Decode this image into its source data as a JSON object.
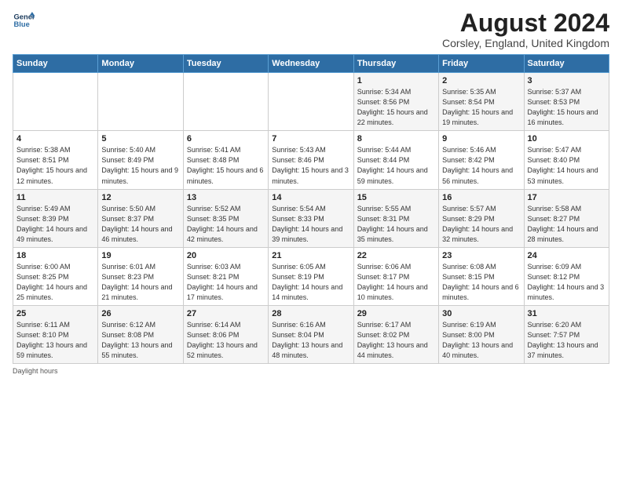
{
  "header": {
    "logo_line1": "General",
    "logo_line2": "Blue",
    "title": "August 2024",
    "subtitle": "Corsley, England, United Kingdom"
  },
  "weekdays": [
    "Sunday",
    "Monday",
    "Tuesday",
    "Wednesday",
    "Thursday",
    "Friday",
    "Saturday"
  ],
  "weeks": [
    [
      {
        "day": "",
        "content": ""
      },
      {
        "day": "",
        "content": ""
      },
      {
        "day": "",
        "content": ""
      },
      {
        "day": "",
        "content": ""
      },
      {
        "day": "1",
        "content": "Sunrise: 5:34 AM\nSunset: 8:56 PM\nDaylight: 15 hours\nand 22 minutes."
      },
      {
        "day": "2",
        "content": "Sunrise: 5:35 AM\nSunset: 8:54 PM\nDaylight: 15 hours\nand 19 minutes."
      },
      {
        "day": "3",
        "content": "Sunrise: 5:37 AM\nSunset: 8:53 PM\nDaylight: 15 hours\nand 16 minutes."
      }
    ],
    [
      {
        "day": "4",
        "content": "Sunrise: 5:38 AM\nSunset: 8:51 PM\nDaylight: 15 hours\nand 12 minutes."
      },
      {
        "day": "5",
        "content": "Sunrise: 5:40 AM\nSunset: 8:49 PM\nDaylight: 15 hours\nand 9 minutes."
      },
      {
        "day": "6",
        "content": "Sunrise: 5:41 AM\nSunset: 8:48 PM\nDaylight: 15 hours\nand 6 minutes."
      },
      {
        "day": "7",
        "content": "Sunrise: 5:43 AM\nSunset: 8:46 PM\nDaylight: 15 hours\nand 3 minutes."
      },
      {
        "day": "8",
        "content": "Sunrise: 5:44 AM\nSunset: 8:44 PM\nDaylight: 14 hours\nand 59 minutes."
      },
      {
        "day": "9",
        "content": "Sunrise: 5:46 AM\nSunset: 8:42 PM\nDaylight: 14 hours\nand 56 minutes."
      },
      {
        "day": "10",
        "content": "Sunrise: 5:47 AM\nSunset: 8:40 PM\nDaylight: 14 hours\nand 53 minutes."
      }
    ],
    [
      {
        "day": "11",
        "content": "Sunrise: 5:49 AM\nSunset: 8:39 PM\nDaylight: 14 hours\nand 49 minutes."
      },
      {
        "day": "12",
        "content": "Sunrise: 5:50 AM\nSunset: 8:37 PM\nDaylight: 14 hours\nand 46 minutes."
      },
      {
        "day": "13",
        "content": "Sunrise: 5:52 AM\nSunset: 8:35 PM\nDaylight: 14 hours\nand 42 minutes."
      },
      {
        "day": "14",
        "content": "Sunrise: 5:54 AM\nSunset: 8:33 PM\nDaylight: 14 hours\nand 39 minutes."
      },
      {
        "day": "15",
        "content": "Sunrise: 5:55 AM\nSunset: 8:31 PM\nDaylight: 14 hours\nand 35 minutes."
      },
      {
        "day": "16",
        "content": "Sunrise: 5:57 AM\nSunset: 8:29 PM\nDaylight: 14 hours\nand 32 minutes."
      },
      {
        "day": "17",
        "content": "Sunrise: 5:58 AM\nSunset: 8:27 PM\nDaylight: 14 hours\nand 28 minutes."
      }
    ],
    [
      {
        "day": "18",
        "content": "Sunrise: 6:00 AM\nSunset: 8:25 PM\nDaylight: 14 hours\nand 25 minutes."
      },
      {
        "day": "19",
        "content": "Sunrise: 6:01 AM\nSunset: 8:23 PM\nDaylight: 14 hours\nand 21 minutes."
      },
      {
        "day": "20",
        "content": "Sunrise: 6:03 AM\nSunset: 8:21 PM\nDaylight: 14 hours\nand 17 minutes."
      },
      {
        "day": "21",
        "content": "Sunrise: 6:05 AM\nSunset: 8:19 PM\nDaylight: 14 hours\nand 14 minutes."
      },
      {
        "day": "22",
        "content": "Sunrise: 6:06 AM\nSunset: 8:17 PM\nDaylight: 14 hours\nand 10 minutes."
      },
      {
        "day": "23",
        "content": "Sunrise: 6:08 AM\nSunset: 8:15 PM\nDaylight: 14 hours\nand 6 minutes."
      },
      {
        "day": "24",
        "content": "Sunrise: 6:09 AM\nSunset: 8:12 PM\nDaylight: 14 hours\nand 3 minutes."
      }
    ],
    [
      {
        "day": "25",
        "content": "Sunrise: 6:11 AM\nSunset: 8:10 PM\nDaylight: 13 hours\nand 59 minutes."
      },
      {
        "day": "26",
        "content": "Sunrise: 6:12 AM\nSunset: 8:08 PM\nDaylight: 13 hours\nand 55 minutes."
      },
      {
        "day": "27",
        "content": "Sunrise: 6:14 AM\nSunset: 8:06 PM\nDaylight: 13 hours\nand 52 minutes."
      },
      {
        "day": "28",
        "content": "Sunrise: 6:16 AM\nSunset: 8:04 PM\nDaylight: 13 hours\nand 48 minutes."
      },
      {
        "day": "29",
        "content": "Sunrise: 6:17 AM\nSunset: 8:02 PM\nDaylight: 13 hours\nand 44 minutes."
      },
      {
        "day": "30",
        "content": "Sunrise: 6:19 AM\nSunset: 8:00 PM\nDaylight: 13 hours\nand 40 minutes."
      },
      {
        "day": "31",
        "content": "Sunrise: 6:20 AM\nSunset: 7:57 PM\nDaylight: 13 hours\nand 37 minutes."
      }
    ]
  ],
  "footer": {
    "daylight_label": "Daylight hours"
  }
}
